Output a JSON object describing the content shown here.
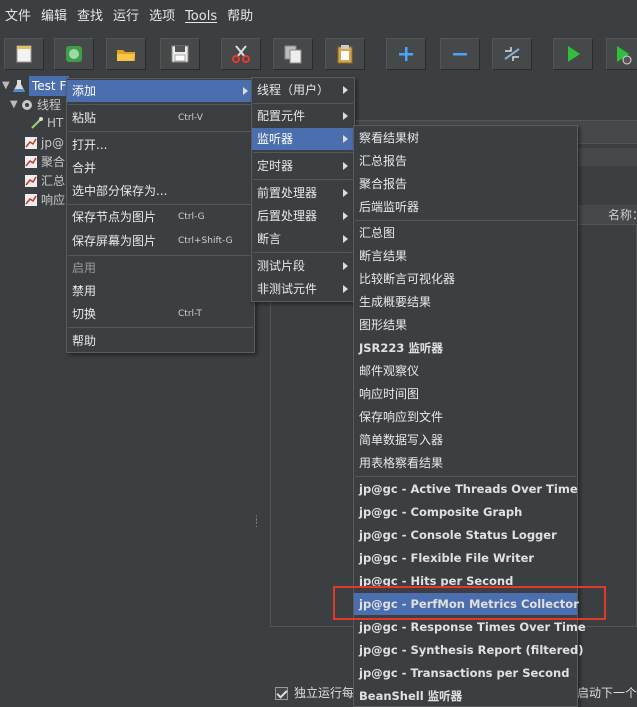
{
  "menubar": {
    "items": [
      "文件",
      "编辑",
      "查找",
      "运行",
      "选项",
      "Tools",
      "帮助"
    ]
  },
  "toolbar": {
    "buttons": [
      "new-icon",
      "templates-icon",
      "open-icon",
      "save-icon",
      "cut-icon",
      "copy-icon",
      "paste-icon",
      "expand-icon",
      "collapse-icon",
      "toggle-icon",
      "start-icon",
      "start-no-pause-icon"
    ]
  },
  "tree": {
    "root": "Test F",
    "thread_group": "线程",
    "http": "HT",
    "jp": "jp@",
    "agg": "聚合",
    "summary": "汇总",
    "resp": "响应"
  },
  "menu1": {
    "add": "添加",
    "paste": "粘贴",
    "paste_sc": "Ctrl-V",
    "open": "打开...",
    "merge": "合并",
    "save_part": "选中部分保存为...",
    "save_node_img": "保存节点为图片",
    "save_node_img_sc": "Ctrl-G",
    "save_screen_img": "保存屏幕为图片",
    "save_screen_img_sc": "Ctrl+Shift-G",
    "enable": "启用",
    "disable": "禁用",
    "toggle": "切换",
    "toggle_sc": "Ctrl-T",
    "help": "帮助"
  },
  "menu2": {
    "threads": "线程（用户）",
    "config": "配置元件",
    "listener": "监听器",
    "timer": "定时器",
    "pre": "前置处理器",
    "post": "后置处理器",
    "assertion": "断言",
    "fragment": "测试片段",
    "non_test": "非测试元件"
  },
  "menu3": {
    "items": [
      "察看结果树",
      "汇总报告",
      "聚合报告",
      "后端监听器",
      "汇总图",
      "断言结果",
      "比较断言可视化器",
      "生成概要结果",
      "图形结果",
      "JSR223 监听器",
      "邮件观察仪",
      "响应时间图",
      "保存响应到文件",
      "简单数据写入器",
      "用表格察看结果",
      "jp@gc - Active Threads Over Time",
      "jp@gc - Composite Graph",
      "jp@gc - Console Status Logger",
      "jp@gc - Flexible File Writer",
      "jp@gc - Hits per Second",
      "jp@gc - PerfMon Metrics Collector",
      "jp@gc - Response Times Over Time",
      "jp@gc - Synthesis Report (filtered)",
      "jp@gc - Transactions per Second",
      "BeanShell 监听器"
    ]
  },
  "right": {
    "col_name": "名称：",
    "checkbox_label": "独立运行每",
    "bottom_right": "启动下一个"
  },
  "colors": {
    "background": "#3c3f41",
    "highlight": "#4b6eaf",
    "annotation": "#e0392b"
  }
}
